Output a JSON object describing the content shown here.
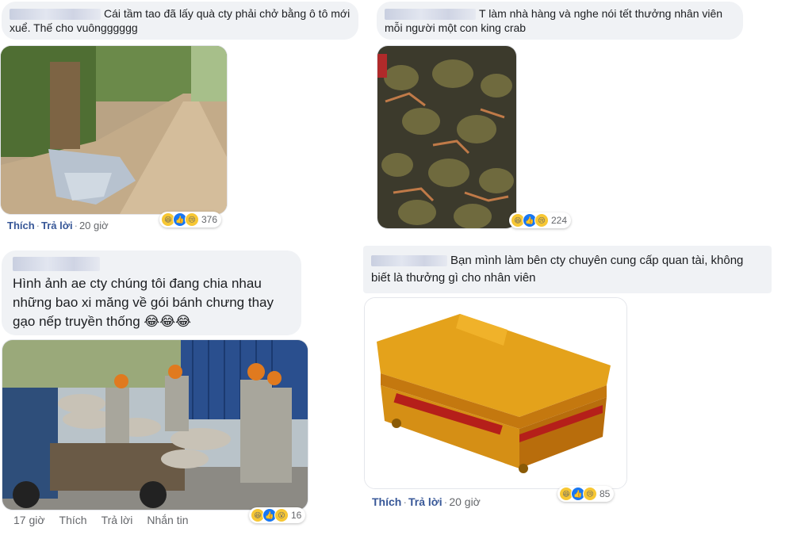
{
  "comments": [
    {
      "text": "Cái tầm tao đã lấy quà cty phải chở bằng ô tô mới xuể. Thế cho vuôngggggg",
      "actions": {
        "like": "Thích",
        "reply": "Trả lời",
        "time": "20 giờ"
      },
      "reactions": {
        "icons": [
          "haha-icon",
          "like-icon",
          "sad-icon"
        ],
        "count": "376"
      }
    },
    {
      "text": "T làm nhà hàng và nghe nói tết thưởng nhân viên mỗi người một con king crab",
      "reactions": {
        "icons": [
          "haha-icon",
          "like-icon",
          "sad-icon"
        ],
        "count": "224"
      }
    },
    {
      "text": "Hình ảnh ae cty chúng tôi đang chia nhau những bao xi măng về gói bánh chưng thay gạo nếp truyền thống 😂😂😂",
      "actions": {
        "time": "17 giờ",
        "like": "Thích",
        "reply": "Trả lời",
        "message": "Nhắn tin"
      },
      "reactions": {
        "icons": [
          "haha-icon",
          "like-icon",
          "wow-icon"
        ],
        "count": "16"
      }
    },
    {
      "text": "Bạn mình làm bên cty chuyên cung cấp quan tài, không biết là thưởng gì cho nhân viên",
      "actions": {
        "like": "Thích",
        "reply": "Trả lời",
        "time": "20 giờ"
      },
      "reactions": {
        "icons": [
          "haha-icon",
          "like-icon",
          "sad-icon"
        ],
        "count": "85"
      }
    }
  ],
  "colors": {
    "bubble": "#f0f2f5",
    "link": "#385898",
    "meta": "#65676b"
  }
}
